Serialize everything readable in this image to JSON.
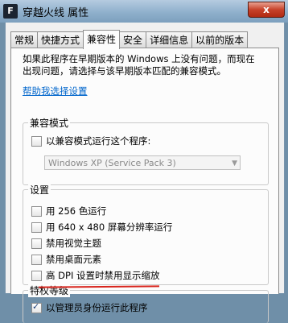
{
  "window": {
    "title": "穿越火线 属性",
    "close_glyph": "x",
    "icon_letter": "F"
  },
  "tabs": [
    {
      "label": "常规"
    },
    {
      "label": "快捷方式"
    },
    {
      "label": "兼容性"
    },
    {
      "label": "安全"
    },
    {
      "label": "详细信息"
    },
    {
      "label": "以前的版本"
    }
  ],
  "compat": {
    "description": "如果此程序在早期版本的 Windows 上没有问题，而现在出现问题，请选择与该早期版本匹配的兼容模式。",
    "help_link": "帮助我选择设置",
    "mode_group": {
      "label": "兼容模式",
      "checkbox_label": "以兼容模式运行这个程序:",
      "select_value": "Windows XP (Service Pack 3)"
    },
    "settings_group": {
      "label": "设置",
      "options": [
        {
          "label": "用 256 色运行"
        },
        {
          "label": "用 640 x 480 屏幕分辨率运行"
        },
        {
          "label": "禁用视觉主题"
        },
        {
          "label": "禁用桌面元素"
        },
        {
          "label": "高 DPI 设置时禁用显示缩放"
        }
      ]
    },
    "privilege_group": {
      "label": "特权等级",
      "checkbox_label": "以管理员身份运行此程序",
      "checked": true
    }
  },
  "colors": {
    "link": "#0066cc",
    "annotation": "#d8241c",
    "close": "#c7422a"
  }
}
